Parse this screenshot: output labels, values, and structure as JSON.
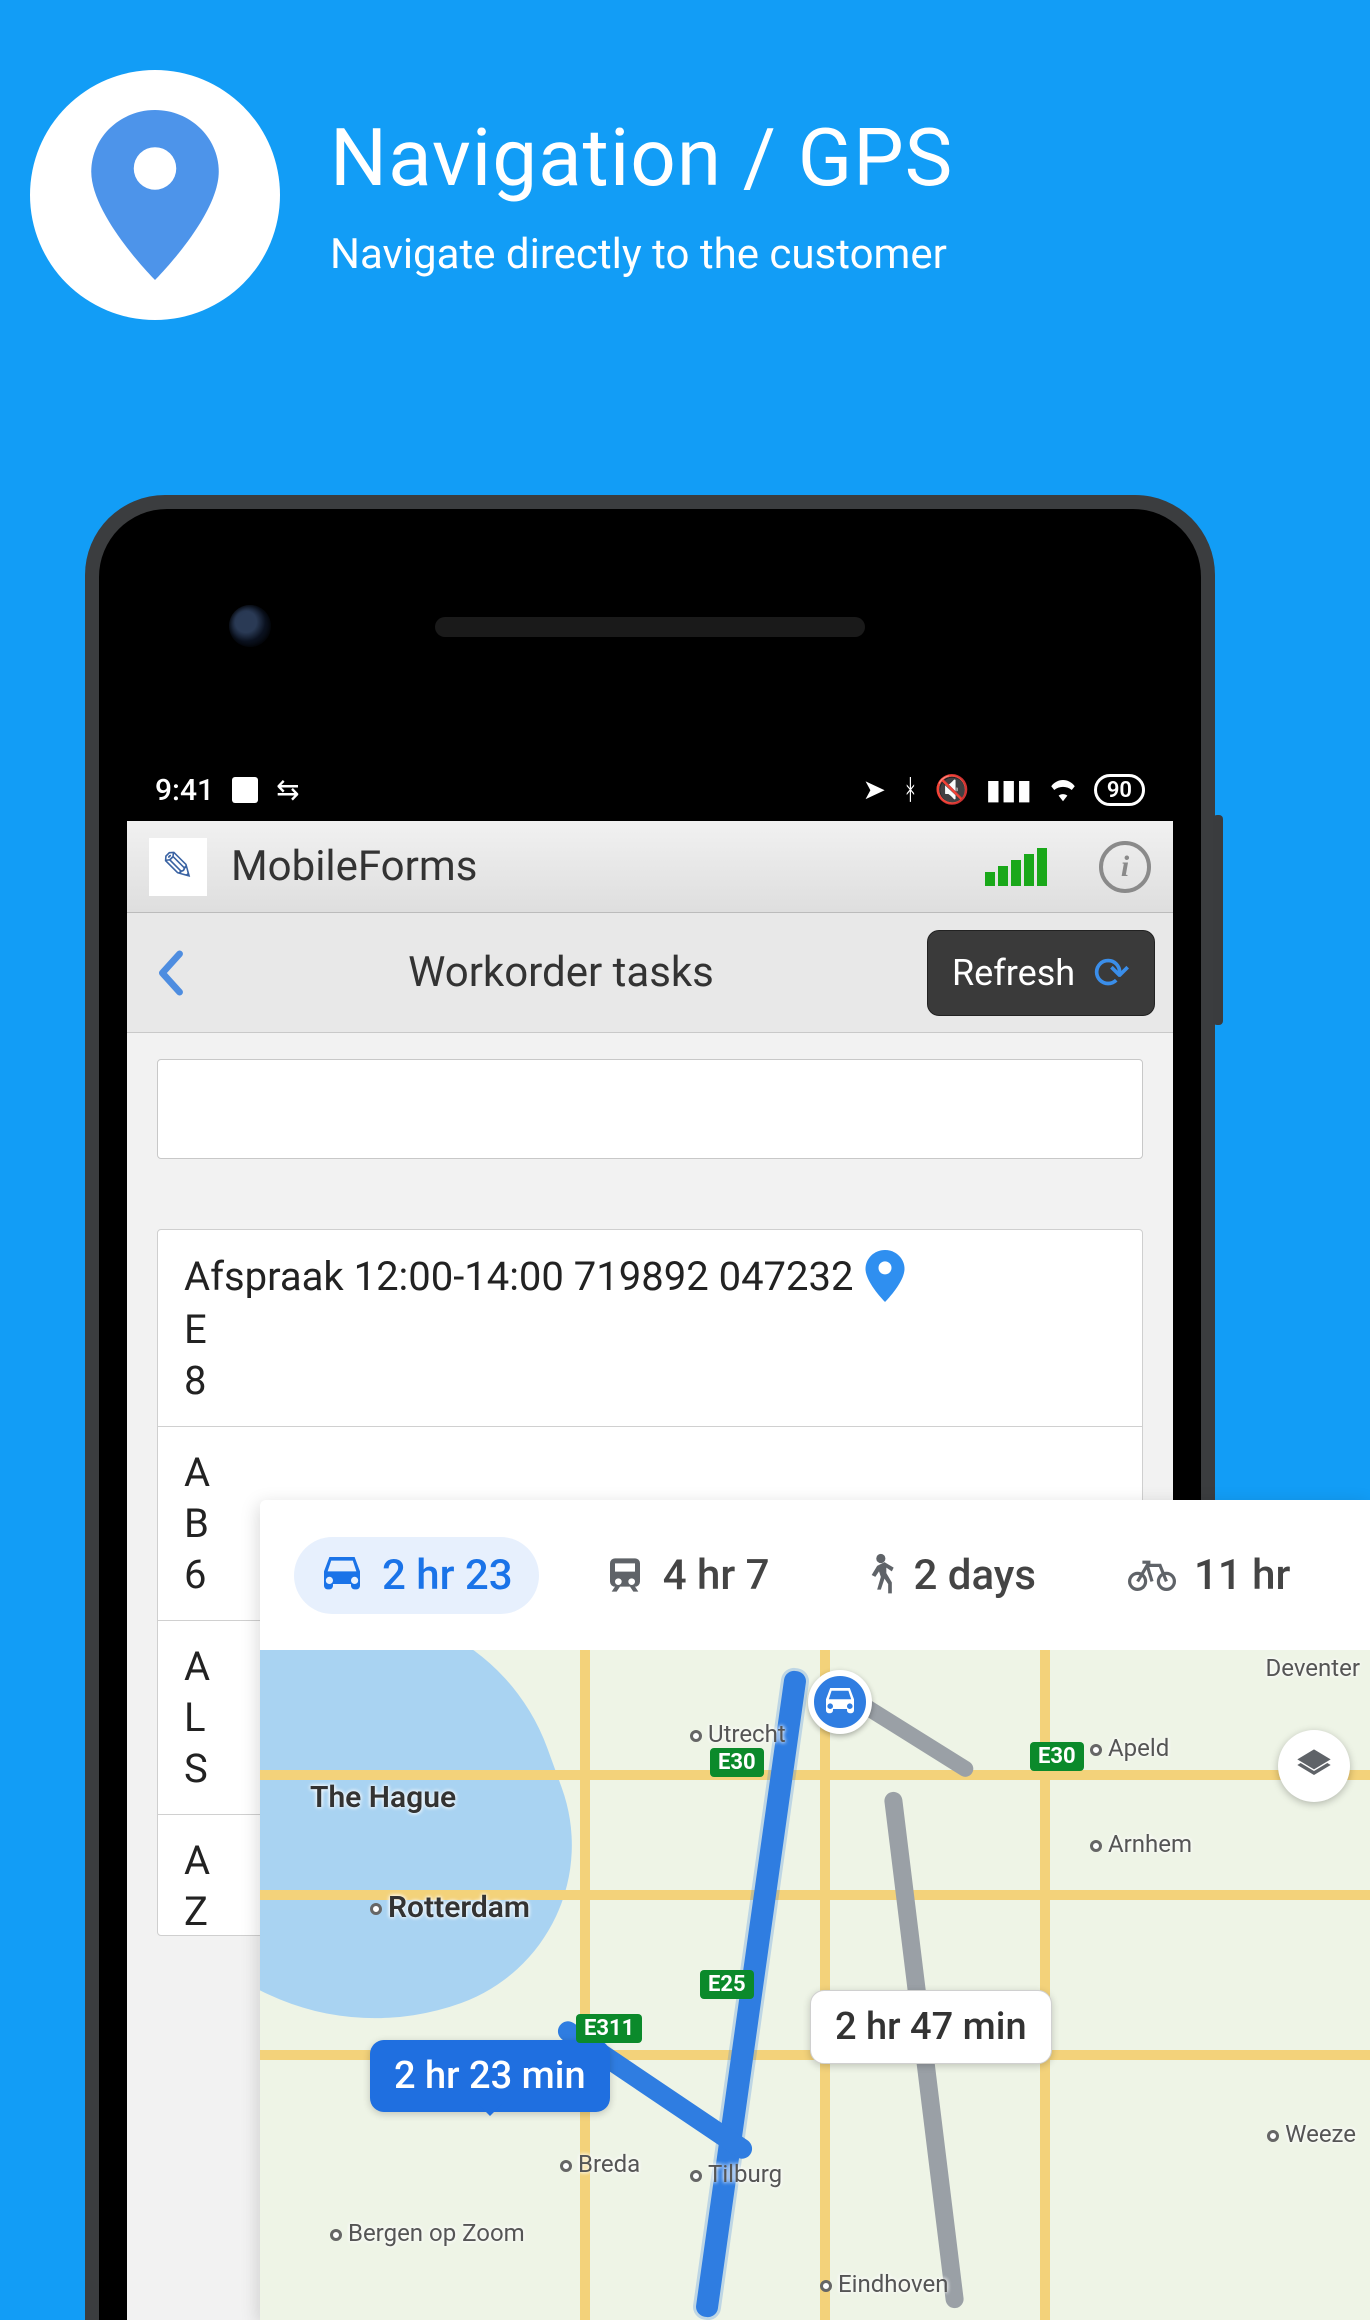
{
  "hero": {
    "title": "Navigation / GPS",
    "subtitle": "Navigate directly to the customer"
  },
  "statusbar": {
    "time": "9:41",
    "battery": "90"
  },
  "app": {
    "title": "MobileForms"
  },
  "subheader": {
    "title": "Workorder tasks",
    "refresh": "Refresh"
  },
  "task": {
    "title": "Afspraak 12:00-14:00 719892 047232",
    "line_e": "E",
    "line_8": "8",
    "line_a1": "A",
    "line_b": "B",
    "line_6": "6",
    "line_a2": "A",
    "line_l": "L",
    "line_s": "S",
    "line_a3": "A",
    "line_z": "Z"
  },
  "maps": {
    "modes": {
      "car": "2 hr 23",
      "train": "4 hr 7",
      "walk": "2 days",
      "bike": "11 hr"
    },
    "route_main_label": "2 hr 23 min",
    "route_alt_label": "2 hr 47 min",
    "shields": {
      "s1": "E30",
      "s2": "E25",
      "s3": "E311",
      "s4": "E30"
    },
    "cities": {
      "thehague": "The Hague",
      "rotterdam": "Rotterdam",
      "utrecht": "Utrecht",
      "apeldoorn": "Apeld",
      "arnhem": "Arnhem",
      "breda": "Breda",
      "tilburg": "Tilburg",
      "eindhoven": "Eindhoven",
      "bergen": "Bergen op Zoom",
      "deventer": "Deventer",
      "weeze": "Weeze"
    }
  }
}
